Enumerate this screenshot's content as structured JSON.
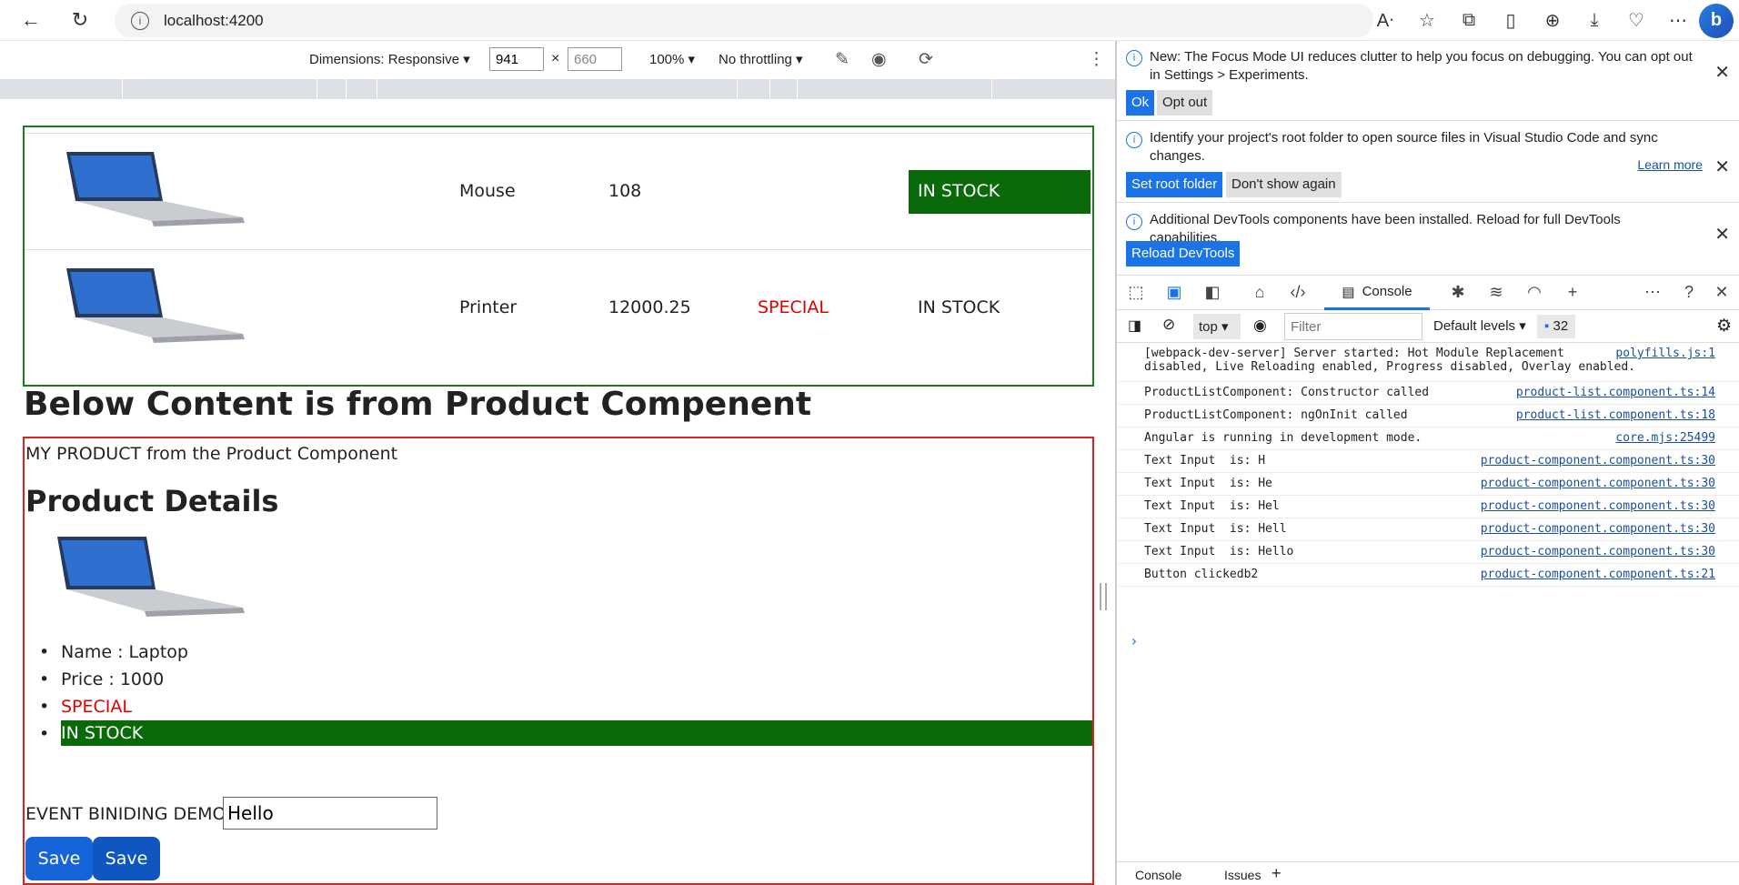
{
  "browser": {
    "url": "localhost:4200"
  },
  "device_toolbar": {
    "dimensions_label": "Dimensions: Responsive ▾",
    "width": "941",
    "times": "×",
    "height": "660",
    "zoom": "100% ▾",
    "throttling": "No throttling ▾"
  },
  "page": {
    "products": [
      {
        "name": "Mouse",
        "price": "108",
        "special": "",
        "stock": "IN STOCK",
        "stock_green": true
      },
      {
        "name": "Printer",
        "price": "12000.25",
        "special": "SPECIAL",
        "stock": "IN STOCK",
        "stock_green": false
      }
    ],
    "heading": "Below Content is from Product Compenent",
    "product_line": "MY PRODUCT from the Product Component",
    "details_heading": "Product Details",
    "details": {
      "name": "Name : Laptop",
      "price": "Price : 1000",
      "special": "SPECIAL",
      "stock": "IN STOCK"
    },
    "event_label": "EVENT BINIDING DEMO",
    "event_input": "Hello",
    "save1": "Save",
    "save2": "Save"
  },
  "devtools": {
    "notice1": "New: The Focus Mode UI reduces clutter to help you focus on debugging. You can opt out in Settings > Experiments.",
    "ok": "Ok",
    "opt_out": "Opt out",
    "notice2": "Identify your project's root folder to open source files in Visual Studio Code and sync changes.",
    "set_root": "Set root folder",
    "dont_show": "Don't show again",
    "learn_more": "Learn more",
    "notice3": "Additional DevTools components have been installed. Reload for full DevTools capabilities.",
    "reload": "Reload DevTools",
    "console_tab": "Console",
    "context": "top ▾",
    "filter_placeholder": "Filter",
    "levels": "Default levels ▾",
    "message_count": "32",
    "logs": [
      {
        "msg": "[webpack-dev-server] Server started: Hot Module Replacement\ndisabled, Live Reloading enabled, Progress disabled, Overlay enabled.",
        "src": "polyfills.js:1"
      },
      {
        "msg": "ProductListComponent: Constructor called",
        "src": "product-list.component.ts:14"
      },
      {
        "msg": "ProductListComponent: ngOnInit called",
        "src": "product-list.component.ts:18"
      },
      {
        "msg": "Angular is running in development mode.",
        "src": "core.mjs:25499"
      },
      {
        "msg": "Text Input  is: H",
        "src": "product-component.component.ts:30"
      },
      {
        "msg": "Text Input  is: He",
        "src": "product-component.component.ts:30"
      },
      {
        "msg": "Text Input  is: Hel",
        "src": "product-component.component.ts:30"
      },
      {
        "msg": "Text Input  is: Hell",
        "src": "product-component.component.ts:30"
      },
      {
        "msg": "Text Input  is: Hello",
        "src": "product-component.component.ts:30"
      },
      {
        "msg": "Button clickedb2",
        "src": "product-component.component.ts:21"
      }
    ],
    "drawer_console": "Console",
    "drawer_issues": "Issues",
    "drawer_add": "+"
  }
}
